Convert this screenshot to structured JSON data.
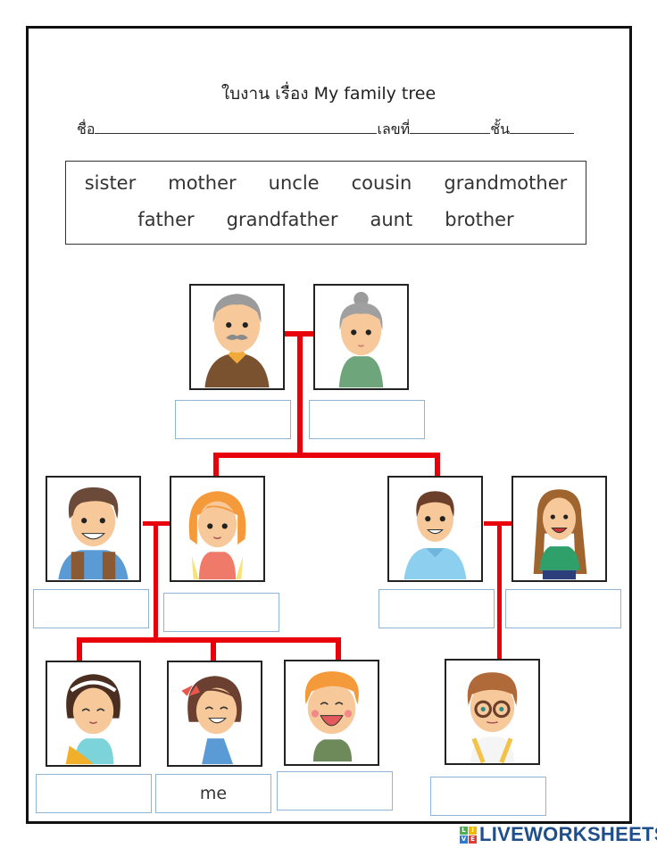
{
  "worksheet": {
    "title": "ใบงาน เรื่อง My family tree",
    "name_label": "ชื่อ",
    "number_label": "เลขที่",
    "class_label": "ชั้น"
  },
  "word_bank": {
    "row1": [
      "sister",
      "mother",
      "uncle",
      "cousin",
      "grandmother"
    ],
    "row2": [
      "father",
      "grandfather",
      "aunt",
      "brother"
    ]
  },
  "people": [
    {
      "id": "grandpa",
      "icon": "grandfather-portrait",
      "answer": ""
    },
    {
      "id": "grandma",
      "icon": "grandmother-portrait",
      "answer": ""
    },
    {
      "id": "dad",
      "icon": "father-portrait",
      "answer": ""
    },
    {
      "id": "mom",
      "icon": "mother-portrait",
      "answer": ""
    },
    {
      "id": "uncle",
      "icon": "uncle-portrait",
      "answer": ""
    },
    {
      "id": "aunt",
      "icon": "aunt-portrait",
      "answer": ""
    },
    {
      "id": "sister",
      "icon": "sister-portrait",
      "answer": ""
    },
    {
      "id": "me",
      "icon": "girl-me-portrait",
      "answer": "me"
    },
    {
      "id": "brother",
      "icon": "brother-portrait",
      "answer": ""
    },
    {
      "id": "cousin",
      "icon": "cousin-portrait",
      "answer": ""
    }
  ],
  "colors": {
    "connector": "#e8000b",
    "answer_border": "#8fb4d6",
    "brand": "#1f4e8c"
  },
  "footer": {
    "brand": "LIVEWORKSHEETS",
    "logo_letters": [
      "L",
      "I",
      "V",
      "E"
    ]
  }
}
